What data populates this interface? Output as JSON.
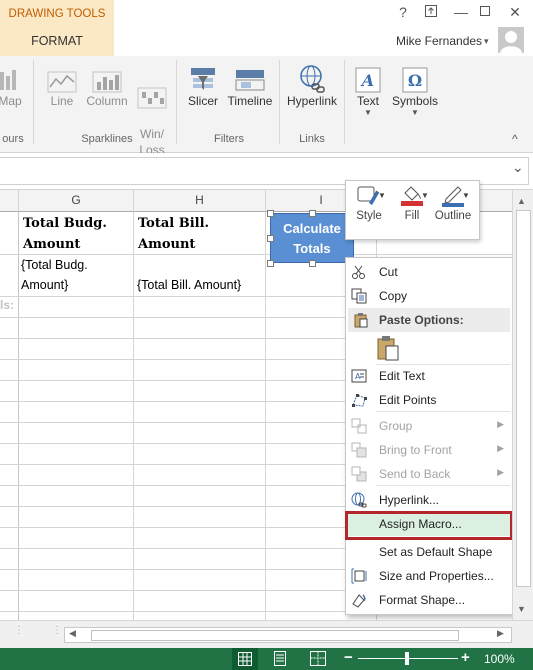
{
  "titlebar": {
    "context_tab": "DRAWING TOOLS",
    "active_tab": "FORMAT",
    "help": "?",
    "restore": "⧉",
    "minimize": "—",
    "close": "✕",
    "user_name": "Mike Fernandes",
    "user_caret": "▾"
  },
  "ribbon": {
    "buttons": [
      {
        "label": "Map",
        "icon": "map-icon"
      },
      {
        "label": "Line",
        "icon": "sparkline-line-icon"
      },
      {
        "label": "Column",
        "icon": "sparkline-column-icon"
      },
      {
        "label": "Win/\nLoss",
        "icon": "sparkline-winloss-icon"
      },
      {
        "label": "Slicer",
        "icon": "slicer-icon"
      },
      {
        "label": "Timeline",
        "icon": "timeline-icon"
      },
      {
        "label": "Hyperlink",
        "icon": "hyperlink-icon"
      },
      {
        "label": "Text",
        "icon": "text-icon"
      },
      {
        "label": "Symbols",
        "icon": "symbols-icon"
      }
    ],
    "groups": {
      "tours": "ours",
      "sparklines": "Sparklines",
      "filters": "Filters",
      "links": "Links"
    },
    "collapse": "^"
  },
  "formula_bar": {
    "expand": "⌄"
  },
  "sheet": {
    "columns": [
      "G",
      "H",
      "I"
    ],
    "cells": {
      "g1": "Total Budg. Amount",
      "h1": "Total Bill. Amount",
      "g2a": "{Total Budg.",
      "g2b": "Amount}",
      "h2": "{Total Bill. Amount}",
      "row_label": "ls:"
    }
  },
  "shape": {
    "line1": "Calculate",
    "line2": "Totals"
  },
  "mini_toolbar": {
    "style": "Style",
    "fill": "Fill",
    "outline": "Outline"
  },
  "context_menu": {
    "cut": "Cut",
    "copy": "Copy",
    "paste_options": "Paste Options:",
    "edit_text": "Edit Text",
    "edit_points": "Edit Points",
    "group": "Group",
    "bring_to_front": "Bring to Front",
    "send_to_back": "Send to Back",
    "hyperlink": "Hyperlink...",
    "assign_macro": "Assign Macro...",
    "set_default_shape": "Set as Default Shape",
    "size_and_properties": "Size and Properties...",
    "format_shape": "Format Shape..."
  },
  "statusbar": {
    "zoom_minus": "−",
    "zoom_plus": "+",
    "zoom_level": "100%"
  },
  "colors": {
    "accent_green": "#217346",
    "context_orange": "#c25c00",
    "shape_blue": "#5b8fd3",
    "highlight_red": "#b2262c"
  }
}
